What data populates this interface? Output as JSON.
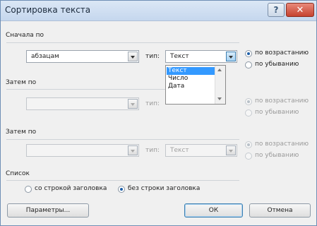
{
  "window": {
    "title": "Сортировка текста",
    "help_label": "?",
    "close_label": "✕"
  },
  "section1": {
    "label": "Сначала по",
    "field_value": "абзацам",
    "type_label": "тип:",
    "type_value": "Текст",
    "asc_label": "по возрастанию",
    "desc_label": "по убыванию",
    "dropdown_options": [
      "Текст",
      "Число",
      "Дата"
    ],
    "dropdown_selected": "Текст"
  },
  "section2": {
    "label": "Затем по",
    "field_value": "",
    "type_label": "тип:",
    "type_value": "",
    "asc_label": "по возрастанию",
    "desc_label": "по убыванию"
  },
  "section3": {
    "label": "Затем по",
    "field_value": "",
    "type_label": "тип:",
    "type_value": "Текст",
    "asc_label": "по возрастанию",
    "desc_label": "по убыванию"
  },
  "list": {
    "label": "Список",
    "with_header": "со строкой заголовка",
    "without_header": "без строки заголовка"
  },
  "buttons": {
    "params": "Параметры...",
    "ok": "ОК",
    "cancel": "Отмена"
  }
}
